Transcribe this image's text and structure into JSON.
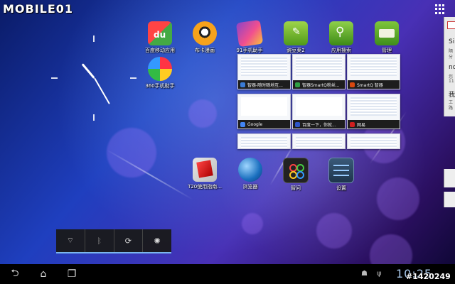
{
  "watermark": "MOBILE01",
  "photo_id": "#1420249",
  "status": {
    "time": "10:25"
  },
  "apps": [
    {
      "label": "百度移动应用",
      "icon": "baidu-du-icon"
    },
    {
      "label": "布卡漫画",
      "icon": "buka-comic-icon"
    },
    {
      "label": "91手机助手",
      "icon": "91-assistant-icon"
    },
    {
      "label": "豌豆荚2",
      "icon": "wandoujia-icon"
    },
    {
      "label": "应用搜索",
      "icon": "app-search-icon"
    },
    {
      "label": "管理",
      "icon": "manager-icon"
    },
    {
      "label": "360手机助手",
      "icon": "360-assistant-icon"
    }
  ],
  "dock_apps": [
    {
      "label": "T20使用指南...",
      "icon": "guide-tablet-icon"
    },
    {
      "label": "浏览器",
      "icon": "browser-globe-icon"
    },
    {
      "label": "智问",
      "icon": "zhiwen-icon"
    },
    {
      "label": "设置",
      "icon": "settings-sliders-icon"
    }
  ],
  "thumbnails": [
    {
      "title": "智器-随时随地互...",
      "color": "#3a7bd5"
    },
    {
      "title": "智器SmartQ粉丝...",
      "color": "#2f9e44"
    },
    {
      "title": "SmartQ 智器",
      "color": "#d9480f"
    },
    {
      "title": "Google",
      "color": "#4285f4"
    },
    {
      "title": "百度一下，你就...",
      "color": "#2d55c8"
    },
    {
      "title": "网易",
      "color": "#d11f1f"
    }
  ],
  "quick_settings": [
    "wifi-icon",
    "bluetooth-icon",
    "sync-icon",
    "settings-icon"
  ],
  "notifications": [
    {
      "title": "Si",
      "sub": "隔",
      "sub2": "分"
    },
    {
      "title": "no",
      "sub": "您",
      "sub2": "11"
    },
    {
      "title": "我",
      "sub": "工",
      "sub2": "路"
    }
  ],
  "nav": [
    "back-icon",
    "home-icon",
    "recent-apps-icon"
  ]
}
